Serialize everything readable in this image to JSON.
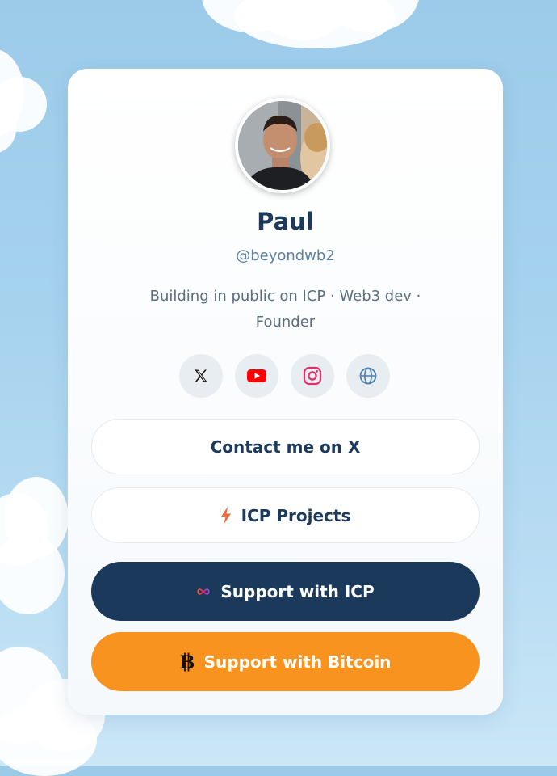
{
  "profile": {
    "name": "Paul",
    "handle": "@beyondwb2",
    "bio": "Building in public on ICP · Web3 dev · Founder"
  },
  "socials": [
    {
      "icon": "x-logo-icon"
    },
    {
      "icon": "youtube-icon"
    },
    {
      "icon": "instagram-icon"
    },
    {
      "icon": "globe-icon"
    }
  ],
  "links": {
    "contact": "Contact me on X",
    "projects": "ICP Projects",
    "support_icp": "Support with ICP",
    "support_btc": "Support with Bitcoin"
  },
  "colors": {
    "navy": "#1b395b",
    "orange": "#f7931e",
    "youtube": "#ff0000",
    "instagram": "#e1306c"
  }
}
